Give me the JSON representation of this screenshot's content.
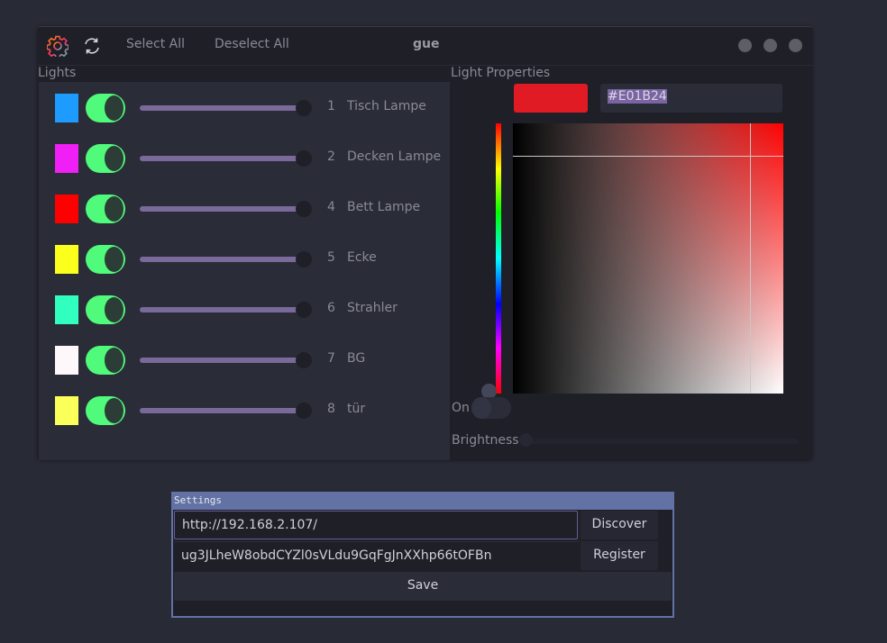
{
  "toolbar": {
    "settings_icon": "gear-icon",
    "refresh_icon": "refresh-icon",
    "select_all": "Select All",
    "deselect_all": "Deselect All",
    "title": "gue",
    "window_buttons": [
      "minimize",
      "maximize",
      "close"
    ]
  },
  "lights": {
    "label": "Lights",
    "items": [
      {
        "id": "1",
        "name": "Tisch Lampe",
        "color": "#1e9bff",
        "on": true,
        "brightness": 1.0
      },
      {
        "id": "2",
        "name": "Decken Lampe",
        "color": "#f01ff5",
        "on": true,
        "brightness": 1.0
      },
      {
        "id": "4",
        "name": "Bett Lampe",
        "color": "#ff0000",
        "on": true,
        "brightness": 1.0
      },
      {
        "id": "5",
        "name": "Ecke",
        "color": "#fbff1b",
        "on": true,
        "brightness": 1.0
      },
      {
        "id": "6",
        "name": "Strahler",
        "color": "#30ffbf",
        "on": true,
        "brightness": 1.0
      },
      {
        "id": "7",
        "name": "BG",
        "color": "#fff8fa",
        "on": true,
        "brightness": 1.0
      },
      {
        "id": "8",
        "name": "tür",
        "color": "#fbff5a",
        "on": true,
        "brightness": 1.0
      }
    ]
  },
  "properties": {
    "label": "Light Properties",
    "color": "#E01B24",
    "hex_value": "#E01B24",
    "hue_position": 1.0,
    "on_label": "On",
    "on": false,
    "brightness_label": "Brightness",
    "brightness": 0.0
  },
  "settings": {
    "title": "Settings",
    "url_value": "http://192.168.2.107/",
    "discover_label": "Discover",
    "token_value": "ug3JLheW8obdCYZl0sVLdu9GqFgJnXXhp66tOFBn",
    "register_label": "Register",
    "save_label": "Save"
  },
  "colors": {
    "accent": "#6272a4",
    "toggle_on": "#50fa7b",
    "slider": "#7a6a9a",
    "selection": "#7a64a4"
  }
}
